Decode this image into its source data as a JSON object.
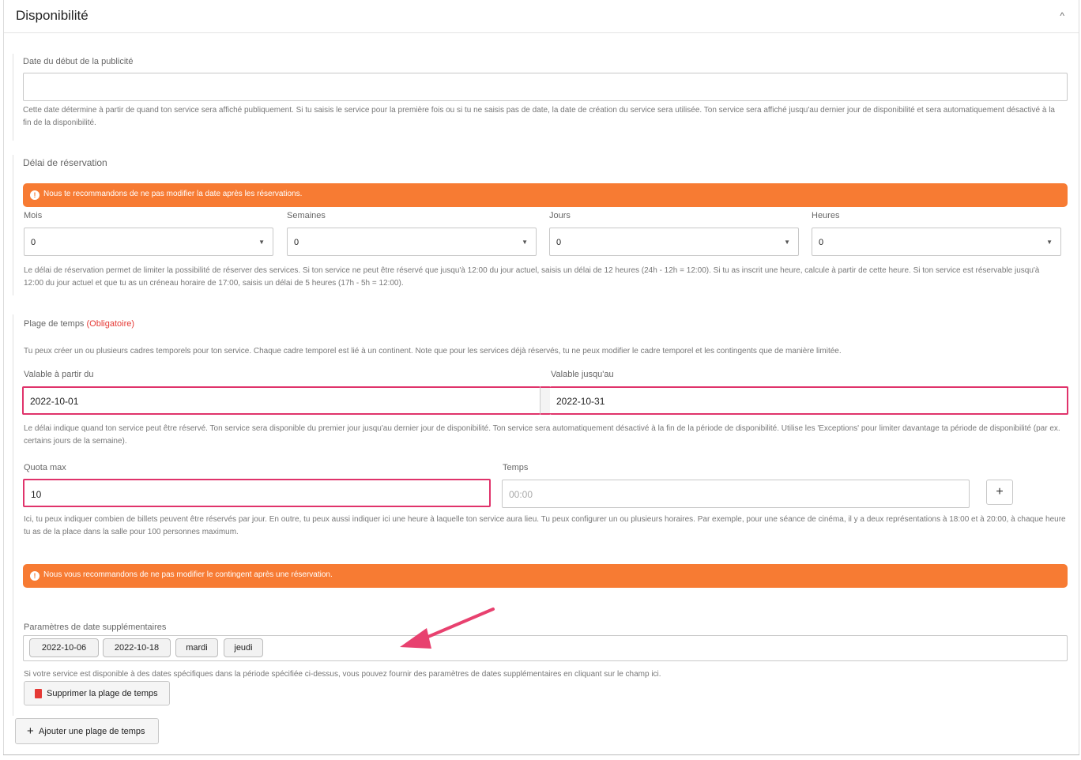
{
  "panel": {
    "title": "Disponibilité",
    "collapse_glyph": "^"
  },
  "pub_date": {
    "label": "Date du début de la publicité",
    "value": "",
    "help": "Cette date détermine à partir de quand ton service sera affiché publiquement. Si tu saisis le service pour la première fois ou si tu ne saisis pas de date, la date de création du service sera utilisée. Ton service sera affiché jusqu'au dernier jour de disponibilité et sera automatiquement désactivé à la fin de la disponibilité."
  },
  "booking_delay": {
    "label": "Délai de réservation",
    "alert": "Nous te recommandons de ne pas modifier la date après les réservations.",
    "fields": [
      {
        "label": "Mois",
        "value": "0"
      },
      {
        "label": "Semaines",
        "value": "0"
      },
      {
        "label": "Jours",
        "value": "0"
      },
      {
        "label": "Heures",
        "value": "0"
      }
    ],
    "help": "Le délai de réservation permet de limiter la possibilité de réserver des services. Si ton service ne peut être réservé que jusqu'à 12:00 du jour actuel, saisis un délai de 12 heures (24h - 12h = 12:00). Si tu as inscrit une heure, calcule à partir de cette heure. Si ton service est réservable jusqu'à 12:00 du jour actuel et que tu as un créneau horaire de 17:00, saisis un délai de 5 heures (17h - 5h = 12:00)."
  },
  "time_range": {
    "label": "Plage de temps",
    "required": "(Obligatoire)",
    "intro": "Tu peux créer un ou plusieurs cadres temporels pour ton service. Chaque cadre temporel est lié à un continent. Note que pour les services déjà réservés, tu ne peux modifier le cadre temporel et les contingents que de manière limitée.",
    "from_label": "Valable à partir du",
    "from_value": "2022-10-01",
    "to_label": "Valable jusqu'au",
    "to_value": "2022-10-31",
    "period_help": "Le délai indique quand ton service peut être réservé. Ton service sera disponible du premier jour jusqu'au dernier jour de disponibilité. Ton service sera automatiquement désactivé à la fin de la période de disponibilité. Utilise les 'Exceptions' pour limiter davantage ta période de disponibilité (par ex. certains jours de la semaine).",
    "quota_label": "Quota max",
    "quota_value": "10",
    "time_label": "Temps",
    "time_placeholder": "00:00",
    "plus_label": "+",
    "quota_help": "Ici, tu peux indiquer combien de billets peuvent être réservés par jour. En outre, tu peux aussi indiquer ici une heure à laquelle ton service aura lieu. Tu peux configurer un ou plusieurs horaires. Par exemple, pour une séance de cinéma, il y a deux représentations à 18:00 et à 20:00, à chaque heure tu as de la place dans la salle pour 100 personnes maximum.",
    "alert": "Nous vous recommandons de ne pas modifier le contingent après une réservation.",
    "extra_label": "Paramètres de date supplémentaires",
    "extra_chips": [
      "2022-10-06",
      "2022-10-18",
      "mardi",
      "jeudi"
    ],
    "extra_help": "Si votre service est disponible à des dates spécifiques dans la période spécifiée ci-dessus, vous pouvez fournir des paramètres de dates supplémentaires en cliquant sur le champ ici.",
    "delete_label": "Supprimer la plage de temps"
  },
  "add_range_label": "Ajouter une plage de temps",
  "colors": {
    "alert": "#f77b33",
    "highlight": "#e0336b",
    "required": "#e53935",
    "delete_icon": "#e53935"
  },
  "icons": [
    "chevron-up-icon",
    "alert-circle-icon",
    "caret-down-icon",
    "plus-icon",
    "trash-icon",
    "annotation-arrow-icon"
  ]
}
